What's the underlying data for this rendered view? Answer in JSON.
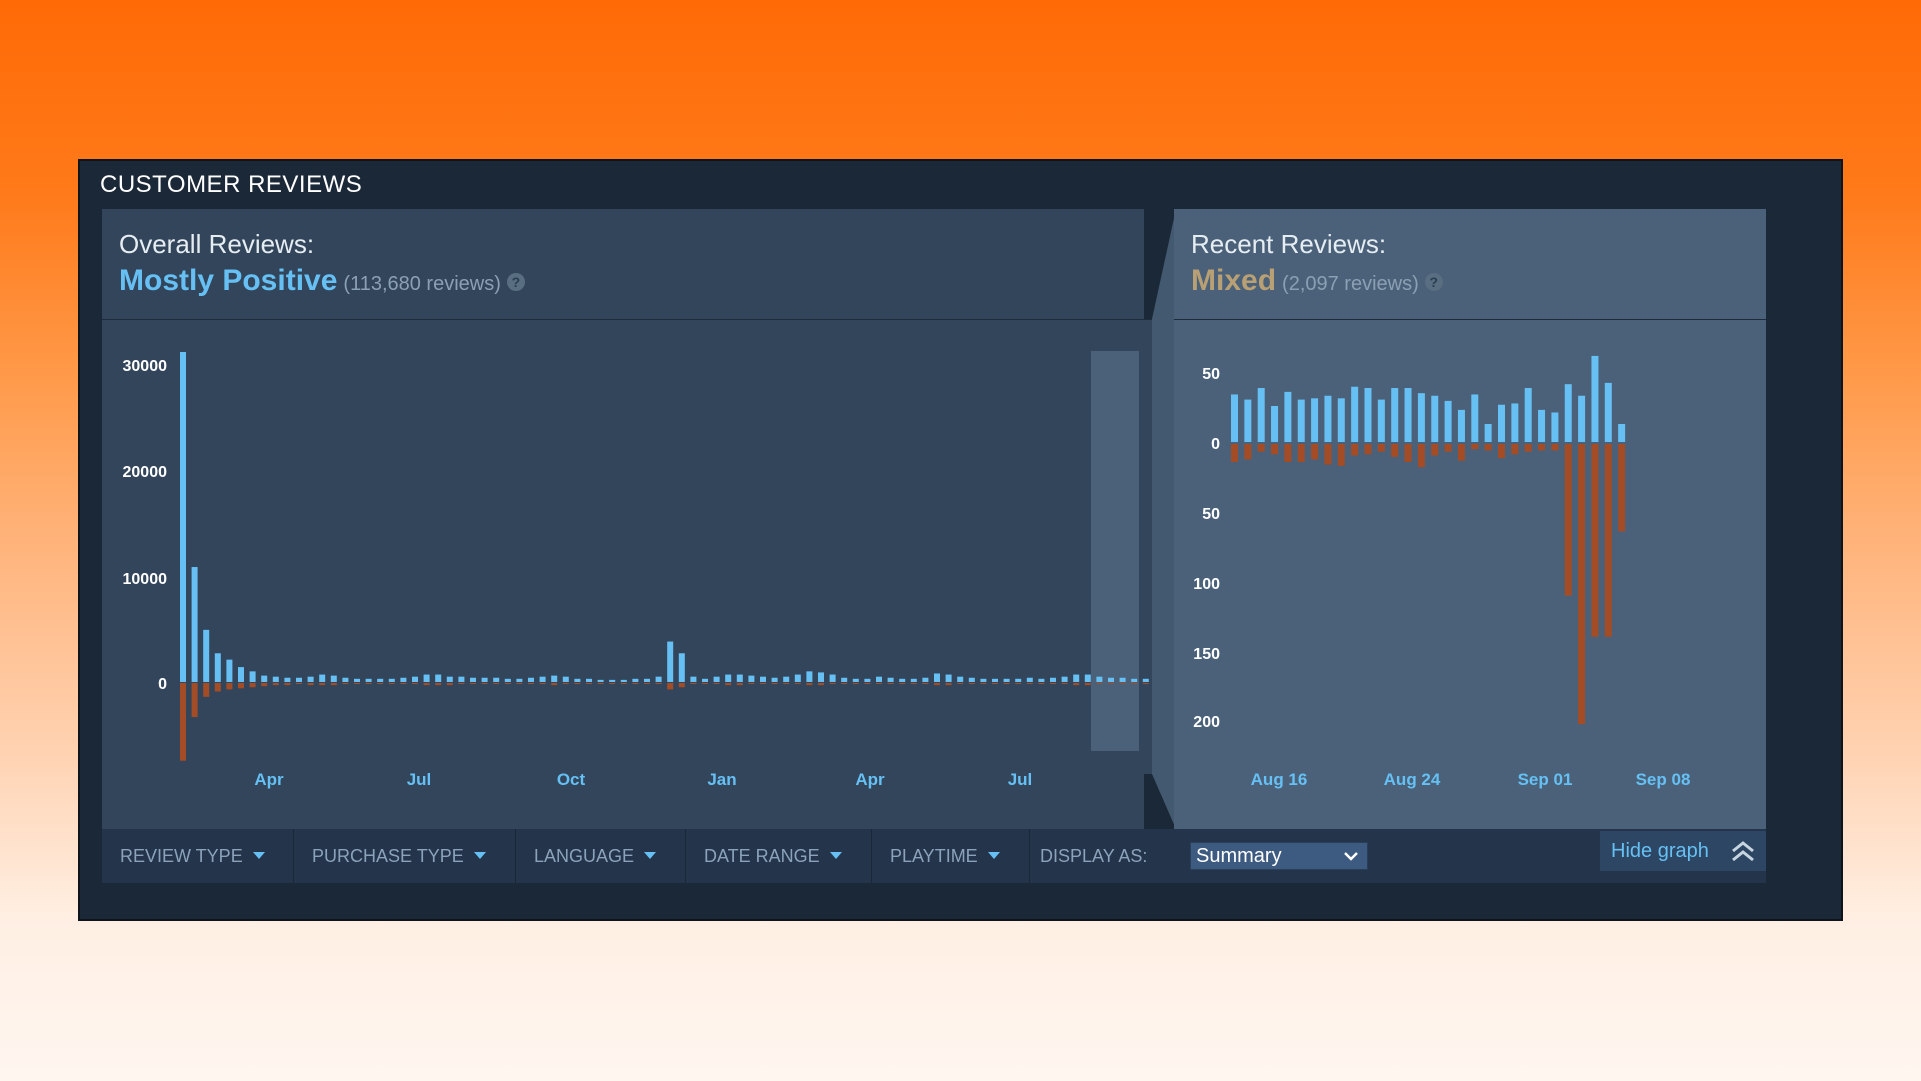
{
  "section_title": "CUSTOMER REVIEWS",
  "overall": {
    "label": "Overall Reviews:",
    "score": "Mostly Positive",
    "count": "(113,680 reviews)",
    "help": "?"
  },
  "recent": {
    "label": "Recent Reviews:",
    "score": "Mixed",
    "count": "(2,097 reviews)",
    "help": "?"
  },
  "filters": [
    {
      "label": "REVIEW TYPE"
    },
    {
      "label": "PURCHASE TYPE"
    },
    {
      "label": "LANGUAGE"
    },
    {
      "label": "DATE RANGE"
    },
    {
      "label": "PLAYTIME"
    }
  ],
  "display_as": {
    "label": "DISPLAY AS:",
    "value": "Summary"
  },
  "hide_graph": {
    "label": "Hide graph"
  },
  "icons": {
    "help": "help-icon",
    "dropdown": "caret-down-icon",
    "select": "chevron-down-icon",
    "collapse": "double-chevron-up-icon"
  },
  "colors": {
    "positive": "#66c0f4",
    "negative": "#a34c25",
    "mixed_text": "#b9a074",
    "accent": "#66c0f4"
  },
  "chart_data": [
    {
      "type": "bar",
      "name": "overall",
      "y_ticks": [
        "30000",
        "20000",
        "10000",
        "0"
      ],
      "x_ticks": [
        "Apr",
        "Jul",
        "Oct",
        "Jan",
        "Apr",
        "Jul"
      ],
      "positive_values": [
        31000,
        10800,
        4900,
        2700,
        2100,
        1400,
        1000,
        600,
        500,
        400,
        400,
        500,
        700,
        600,
        400,
        300,
        300,
        300,
        300,
        400,
        500,
        700,
        700,
        500,
        500,
        400,
        400,
        400,
        300,
        300,
        400,
        500,
        600,
        500,
        300,
        300,
        200,
        200,
        200,
        300,
        300,
        500,
        3800,
        2700,
        500,
        300,
        500,
        700,
        700,
        600,
        500,
        400,
        500,
        700,
        1000,
        900,
        700,
        400,
        300,
        300,
        500,
        400,
        300,
        300,
        400,
        800,
        700,
        500,
        400,
        300,
        300,
        300,
        300,
        400,
        300,
        400,
        500,
        700,
        700,
        500,
        400,
        400,
        300,
        300,
        200,
        200,
        200,
        200
      ],
      "negative_values": [
        7300,
        3200,
        1300,
        800,
        600,
        500,
        400,
        300,
        200,
        200,
        100,
        200,
        200,
        200,
        100,
        100,
        100,
        100,
        100,
        100,
        100,
        200,
        200,
        200,
        100,
        100,
        100,
        100,
        100,
        100,
        100,
        100,
        200,
        100,
        100,
        100,
        100,
        100,
        100,
        100,
        100,
        100,
        600,
        400,
        100,
        100,
        100,
        200,
        200,
        100,
        100,
        100,
        100,
        100,
        200,
        200,
        100,
        100,
        100,
        100,
        100,
        100,
        100,
        100,
        100,
        200,
        200,
        100,
        100,
        100,
        100,
        100,
        100,
        100,
        100,
        100,
        100,
        200,
        200,
        100,
        100,
        100,
        100,
        100,
        100,
        200,
        300,
        600
      ],
      "ylim": [
        -7300,
        31000
      ]
    },
    {
      "type": "bar",
      "name": "recent",
      "y_ticks": [
        "50",
        "0",
        "50",
        "100",
        "150",
        "200"
      ],
      "x_ticks": [
        "Aug 16",
        "Aug 24",
        "Sep 01",
        "Sep 08"
      ],
      "positive_values": [
        37,
        33,
        42,
        28,
        39,
        33,
        34,
        36,
        34,
        43,
        42,
        33,
        42,
        42,
        38,
        36,
        32,
        25,
        37,
        14,
        29,
        30,
        42,
        25,
        23,
        45,
        36,
        67,
        46,
        14
      ],
      "negative_values": [
        14,
        12,
        6,
        8,
        14,
        14,
        12,
        16,
        17,
        9,
        8,
        6,
        10,
        14,
        18,
        9,
        6,
        13,
        4,
        5,
        11,
        8,
        6,
        5,
        5,
        118,
        218,
        150,
        150,
        68
      ],
      "ylim": [
        -218,
        67
      ]
    }
  ]
}
